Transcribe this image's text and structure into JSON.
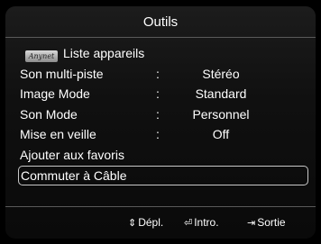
{
  "header": {
    "title": "Outils"
  },
  "menu": {
    "items": [
      {
        "label": "Liste appareils",
        "logo_text": "Anynet"
      },
      {
        "label": "Son multi-piste",
        "colon": ":",
        "value": "Stéréo"
      },
      {
        "label": "Image Mode",
        "colon": ":",
        "value": "Standard"
      },
      {
        "label": "Son Mode",
        "colon": ":",
        "value": "Personnel"
      },
      {
        "label": "Mise en veille",
        "colon": ":",
        "value": "Off"
      },
      {
        "label": "Ajouter aux favoris"
      },
      {
        "label": "Commuter à Câble",
        "selected": true
      }
    ]
  },
  "footer": {
    "move": {
      "icon": "up-down-arrows-icon",
      "glyph": "⇕",
      "label": "Dépl."
    },
    "enter": {
      "icon": "enter-icon",
      "glyph": "⏎",
      "label": "Intro."
    },
    "exit": {
      "icon": "exit-icon",
      "glyph": "⇥",
      "label": "Sortie"
    }
  }
}
